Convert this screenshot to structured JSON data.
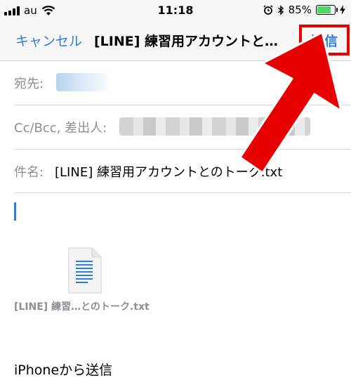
{
  "status_bar": {
    "carrier": "au",
    "time": "11:18",
    "battery_percent": "85%",
    "battery_level": 0.85,
    "icons": [
      "signal-icon",
      "wifi-icon",
      "alarm-icon",
      "bluetooth-icon",
      "battery-icon",
      "charging-icon"
    ]
  },
  "nav": {
    "cancel_label": "キャンセル",
    "title": "[LINE] 練習用アカウントと…",
    "send_label": "送信"
  },
  "fields": {
    "to_label": "宛先:",
    "cc_label": "Cc/Bcc, 差出人:",
    "subject_label": "件名:",
    "subject_value": "[LINE] 練習用アカウントとのトーク.txt"
  },
  "attachment": {
    "icon": "text-file-icon",
    "name": "[LINE] 練習…とのトーク.txt"
  },
  "signature": "iPhoneから送信",
  "colors": {
    "accent": "#2f7ed8",
    "highlight": "#e60000",
    "battery": "#4cd964"
  }
}
